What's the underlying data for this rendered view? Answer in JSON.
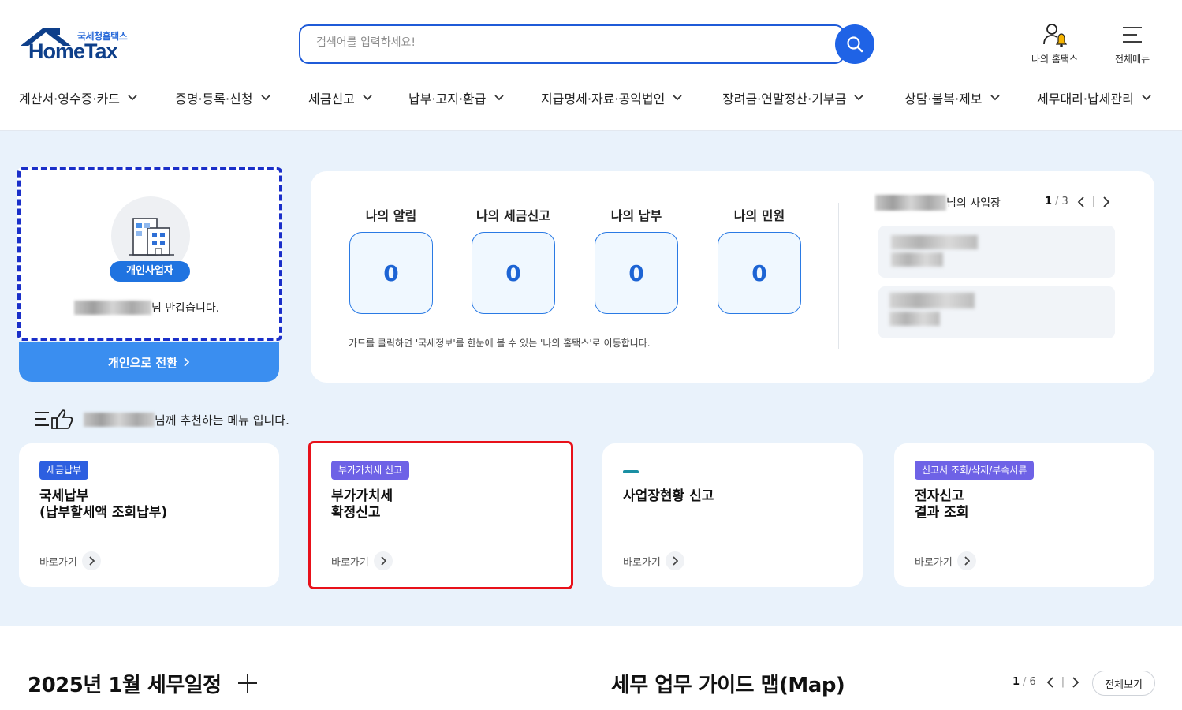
{
  "header": {
    "logo_sub": "국세청홈택스",
    "logo_main": "HomeTax",
    "search_placeholder": "검색어를 입력하세요!",
    "my_hometax_label": "나의 홈택스",
    "all_menu_label": "전체메뉴"
  },
  "nav": {
    "items": [
      "계산서·영수증·카드",
      "증명·등록·신청",
      "세금신고",
      "납부·고지·환급",
      "지급명세·자료·공익법인",
      "장려금·연말정산·기부금",
      "상담·불복·제보",
      "세무대리·납세관리"
    ]
  },
  "profile": {
    "badge": "개인사업자",
    "greeting_suffix": "님 반갑습니다.",
    "switch_label": "개인으로 전환"
  },
  "dashboard": {
    "stats": [
      {
        "title": "나의 알림",
        "value": "0"
      },
      {
        "title": "나의 세금신고",
        "value": "0"
      },
      {
        "title": "나의 납부",
        "value": "0"
      },
      {
        "title": "나의 민원",
        "value": "0"
      }
    ],
    "note": "카드를 클릭하면 '국세정보'를 한눈에 볼 수 있는 '나의 홈택스'로 이동합니다.",
    "biz_title_suffix": "님의 사업장",
    "biz_page_current": "1",
    "biz_page_total": "3"
  },
  "recommend": {
    "suffix": "님께 추천하는 메뉴 입니다."
  },
  "menu_cards": [
    {
      "tag": "세금납부",
      "title1": "국세납부",
      "title2": "(납부할세액 조회납부)",
      "link": "바로가기"
    },
    {
      "tag": "부가가치세 신고",
      "title1": "부가가치세",
      "title2": "확정신고",
      "link": "바로가기"
    },
    {
      "tag": "",
      "title1": "사업장현황 신고",
      "title2": "",
      "link": "바로가기"
    },
    {
      "tag": "신고서 조회/삭제/부속서류",
      "title1": "전자신고",
      "title2": "결과 조회",
      "link": "바로가기"
    }
  ],
  "bottom": {
    "schedule_title": "2025년 1월 세무일정",
    "guide_title": "세무 업무 가이드 맵(Map)",
    "guide_page_current": "1",
    "guide_page_total": "6",
    "view_all": "전체보기"
  },
  "colors": {
    "primary": "#1f63e6",
    "highlight_border": "#e8111a",
    "focus_dashed": "#1a2fc9",
    "main_bg": "#e9f2fb"
  }
}
